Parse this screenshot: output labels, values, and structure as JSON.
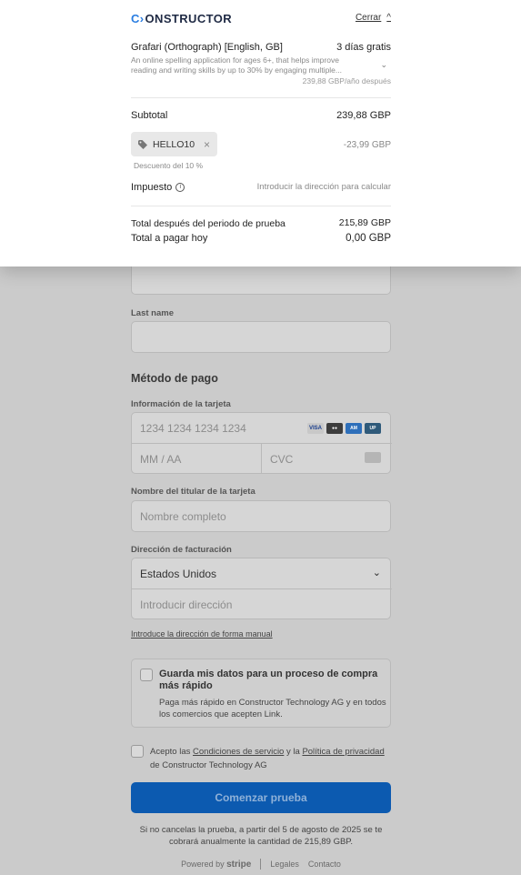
{
  "summary": {
    "logo_mark": "C›",
    "logo_text": "ONSTRUCTOR",
    "close_label": "Cerrar",
    "product": {
      "name": "Grafari (Orthograph) [English, GB]",
      "trial": "3 días gratis",
      "description": "An online spelling application for ages 6+, that helps improve reading and writing skills by up to 30% by engaging multiple...",
      "after_price": "239,88 GBP/año después"
    },
    "subtotal_label": "Subtotal",
    "subtotal_value": "239,88 GBP",
    "promo_code": "HELLO10",
    "discount_value": "-23,99 GBP",
    "discount_note": "Descuento del 10 %",
    "tax_label": "Impuesto",
    "tax_value": "Introducir la dirección para calcular",
    "after_trial_label": "Total después del periodo de prueba",
    "after_trial_value": "215,89 GBP",
    "due_label": "Total a pagar hoy",
    "due_value": "0,00 GBP"
  },
  "form": {
    "last_name_label": "Last name",
    "payment_title": "Método de pago",
    "card_info_label": "Información de la tarjeta",
    "card_number_placeholder": "1234 1234 1234 1234",
    "card_brands": [
      "VISA",
      "MC",
      "AMEX",
      "UnionPay"
    ],
    "expiry_placeholder": "MM / AA",
    "cvc_placeholder": "CVC",
    "cardholder_label": "Nombre del titular de la tarjeta",
    "cardholder_placeholder": "Nombre completo",
    "billing_label": "Dirección de facturación",
    "country_value": "Estados Unidos",
    "address_placeholder": "Introducir dirección",
    "manual_address_link": "Introduce la dirección de forma manual",
    "link_title": "Guarda mis datos para un proceso de compra más rápido",
    "link_desc": "Paga más rápido en Constructor Technology AG y en todos los comercios que acepten Link.",
    "terms_prefix": "Acepto las",
    "terms_link": "Condiciones de servicio",
    "terms_and": "y la",
    "privacy_link": "Política de privacidad",
    "terms_suffix": "de Constructor Technology AG",
    "submit_label": "Comenzar prueba",
    "trial_notice": "Si no cancelas la prueba, a partir del 5 de agosto de 2025 se te cobrará anualmente la cantidad de 215,89 GBP.",
    "footer": {
      "powered_by": "Powered by",
      "stripe": "stripe",
      "legal": "Legales",
      "contact": "Contacto"
    }
  },
  "colors": {
    "accent": "#0c5ab0",
    "logo_mark": "#2a7de1",
    "scrim": "#cbcbcb"
  }
}
